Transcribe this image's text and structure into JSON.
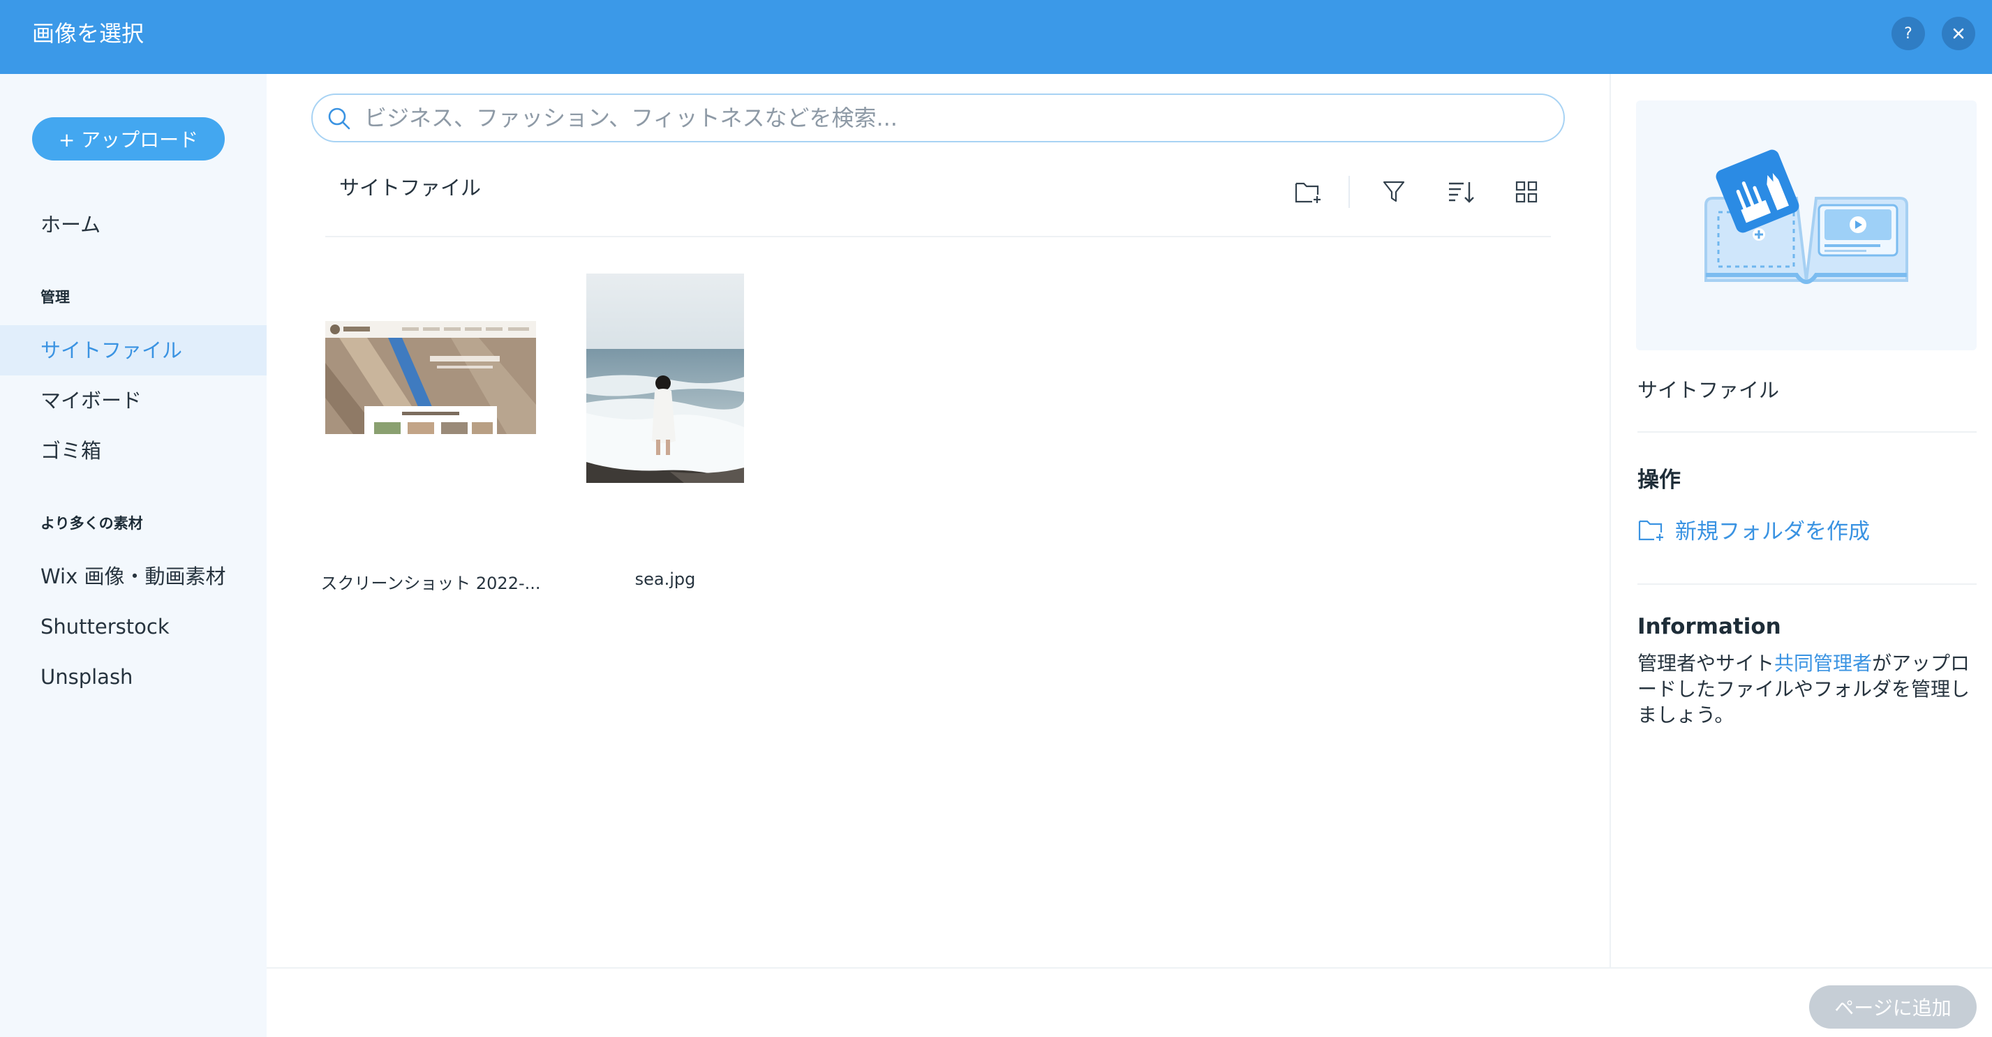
{
  "header": {
    "title": "画像を選択",
    "help_label": "?",
    "close_label": "×",
    "bg_color": "#3b99e8"
  },
  "sidebar": {
    "upload_label": "+ アップロード",
    "items": [
      {
        "label": "ホーム"
      },
      {
        "label": "サイトファイル",
        "active": true
      },
      {
        "label": "マイボード"
      },
      {
        "label": "ゴミ箱"
      },
      {
        "label": "Wix 画像・動画素材"
      },
      {
        "label": "Shutterstock"
      },
      {
        "label": "Unsplash"
      }
    ],
    "sections": {
      "manage": "管理",
      "more": "より多くの素材"
    }
  },
  "main": {
    "search": {
      "placeholder": "ビジネス、ファッション、フィットネスなどを検索..."
    },
    "breadcrumb": "サイトファイル",
    "toolbar_icons": [
      "new-folder-icon",
      "filter-icon",
      "sort-icon",
      "grid-view-icon"
    ],
    "files": [
      {
        "name": "スクリーンショット 2022-..."
      },
      {
        "name": "sea.jpg"
      }
    ]
  },
  "right_panel": {
    "folder_name": "サイトファイル",
    "actions_heading": "操作",
    "new_folder_label": "新規フォルダを作成",
    "info_heading": "Information",
    "info_text_before": "管理者やサイト",
    "info_link": "共同管理者",
    "info_text_after": "がアップロードしたファイルやフォルダを管理しましょう。"
  },
  "footer": {
    "add_button_label": "ページに追加"
  }
}
